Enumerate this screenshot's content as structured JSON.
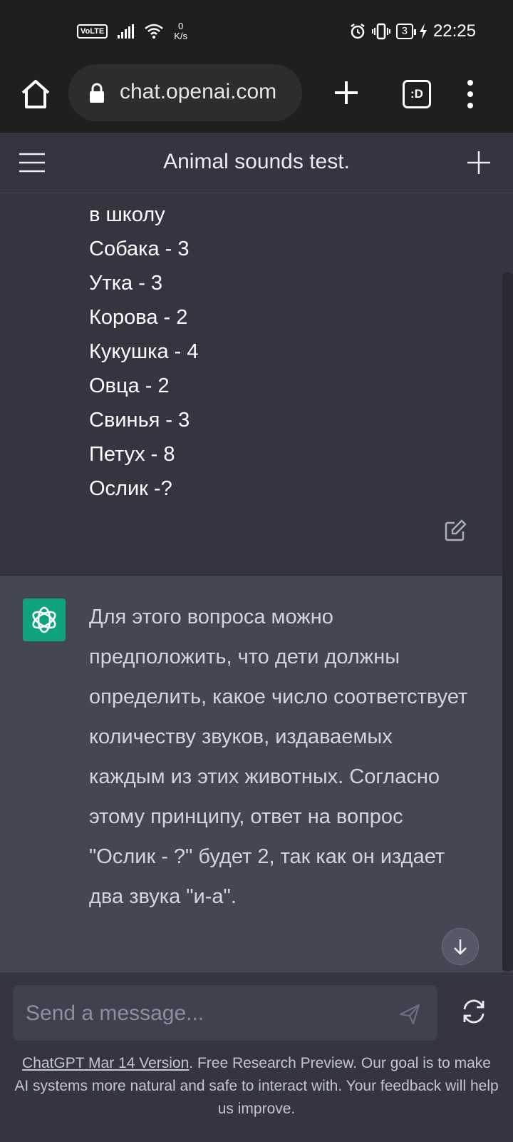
{
  "status_bar": {
    "volte": "VoLTE",
    "net_speed_value": "0",
    "net_speed_unit": "K/s",
    "battery": "3",
    "time": "22:25"
  },
  "browser": {
    "url": "chat.openai.com",
    "tabs_label": ":D"
  },
  "chat": {
    "title": "Animal sounds test."
  },
  "user_message": {
    "lines": [
      "в школу",
      "Собака - 3",
      "Утка - 3",
      "Корова - 2",
      "Кукушка - 4",
      "Овца - 2",
      "Свинья - 3",
      "Петух - 8",
      "Ослик -?"
    ]
  },
  "assistant_message": {
    "text": "Для этого вопроса можно предположить, что дети должны определить, какое число соответствует количеству звуков, издаваемых каждым из этих животных. Согласно этому принципу, ответ на вопрос \"Ослик - ?\" будет 2, так как он издает два звука \"и-а\"."
  },
  "composer": {
    "placeholder": "Send a message..."
  },
  "footer": {
    "version_link": "ChatGPT Mar 14 Version",
    "text": ". Free Research Preview. Our goal is to make AI systems more natural and safe to interact with. Your feedback will help us improve."
  },
  "colors": {
    "page_bg": "#343541",
    "assistant_bg": "#444654",
    "avatar": "#10a37f",
    "input_bg": "#40414f"
  }
}
